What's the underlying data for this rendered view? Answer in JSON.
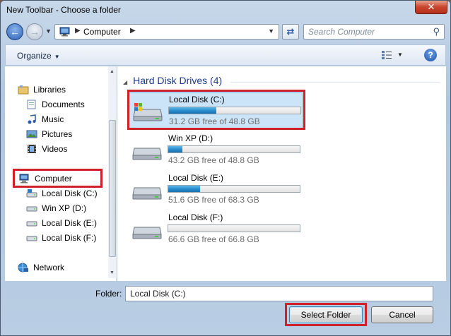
{
  "window": {
    "title": "New Toolbar - Choose a folder",
    "close_label": "✕"
  },
  "nav": {
    "back_icon": "back-arrow-icon",
    "forward_icon": "forward-arrow-icon",
    "address": {
      "segments": [
        "Computer"
      ]
    },
    "search_placeholder": "Search Computer"
  },
  "toolbar": {
    "organize_label": "Organize",
    "help_label": "?"
  },
  "tree": {
    "items": [
      {
        "label": "Libraries",
        "icon": "libraries-icon"
      },
      {
        "label": "Documents",
        "icon": "documents-icon"
      },
      {
        "label": "Music",
        "icon": "music-icon"
      },
      {
        "label": "Pictures",
        "icon": "pictures-icon"
      },
      {
        "label": "Videos",
        "icon": "videos-icon"
      },
      {
        "label": "Computer",
        "icon": "computer-icon"
      },
      {
        "label": "Local Disk (C:)",
        "icon": "drive-icon"
      },
      {
        "label": "Win XP (D:)",
        "icon": "drive-icon"
      },
      {
        "label": "Local Disk (E:)",
        "icon": "drive-icon"
      },
      {
        "label": "Local Disk (F:)",
        "icon": "drive-icon"
      },
      {
        "label": "Network",
        "icon": "network-icon"
      }
    ]
  },
  "main": {
    "group_header": "Hard Disk Drives (4)",
    "drives": [
      {
        "name": "Local Disk (C:)",
        "free": "31.2 GB free of 48.8 GB",
        "used_fraction": 0.36,
        "selected": true
      },
      {
        "name": "Win XP (D:)",
        "free": "43.2 GB free of 48.8 GB",
        "used_fraction": 0.11,
        "selected": false
      },
      {
        "name": "Local Disk (E:)",
        "free": "51.6 GB free of 68.3 GB",
        "used_fraction": 0.24,
        "selected": false
      },
      {
        "name": "Local Disk (F:)",
        "free": "66.6 GB free of 66.8 GB",
        "used_fraction": 0.0,
        "selected": false
      }
    ]
  },
  "footer": {
    "folder_label": "Folder:",
    "folder_value": "Local Disk (C:)",
    "select_label": "Select Folder",
    "cancel_label": "Cancel"
  },
  "colors": {
    "highlight": "#d0202a",
    "accent": "#2a8fcf"
  }
}
